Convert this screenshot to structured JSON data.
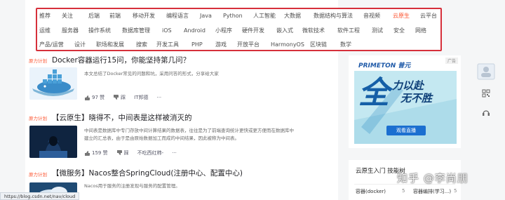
{
  "categories": {
    "row1": [
      "推荐",
      "关注",
      "后端",
      "前端",
      "移动开发",
      "编程语言",
      "Java",
      "Python",
      "人工智能",
      "大数据",
      "数据结构与算法",
      "音视频",
      "云原生",
      "云平台"
    ],
    "row2": [
      "运维",
      "服务器",
      "操作系统",
      "数据库管理",
      "iOS",
      "Android",
      "小程序",
      "硬件开发",
      "嵌入式",
      "微软技术",
      "软件工程",
      "测试",
      "安全",
      "网络"
    ],
    "row3": [
      "产品/运营",
      "设计",
      "职场和发展",
      "搜索",
      "开发工具",
      "PHP",
      "游戏",
      "开放平台",
      "HarmonyOS",
      "区块链",
      "数学"
    ],
    "active": "云原生"
  },
  "articles": [
    {
      "source": "原力计划",
      "title": "Docker容器运行15问，你能坚持第几问？",
      "desc": "本文总结了Docker常见的问题和坑，采用问答的形式，分享给大家",
      "likes": "97 赞",
      "dislike": "踩",
      "author": "IT邦德"
    },
    {
      "source": "原力计划",
      "title": "【云原生】晓得不，中间表是这样被消灭的",
      "desc1": "中间表是数据库中专门存放中间计算结果的数据表，往往是为了前端查询统计更快或更方便而在数据库中",
      "desc2": "建立的汇总表，由于是由原始数据加工而成的中间结果，因此被称为中间表。",
      "likes": "159 赞",
      "dislike": "踩",
      "author": "不吃西红柿-"
    },
    {
      "source": "原力计划",
      "title": "【微服务】Nacos整合SpringCloud(注册中心、配置中心)",
      "desc": "Nacos用于服务的注册发现与服务的配置管理。"
    }
  ],
  "ad": {
    "badge": "广告",
    "brand": "PRIMETON 普元",
    "headline1": "力以赴",
    "headline2": "无不胜",
    "big_char": "全",
    "cta": "观看直播"
  },
  "tagbox": {
    "title": "云原生入门 技能树",
    "tags": [
      "容器(docker)",
      "容器编排(学习...)"
    ],
    "counts": [
      "5",
      "5"
    ]
  },
  "watermark": "知乎 @李尚朋",
  "status_url": "https://blog.csdn.net/nav/cloud",
  "colors": {
    "accent": "#fc5531",
    "highlight_border": "#d6303b"
  }
}
